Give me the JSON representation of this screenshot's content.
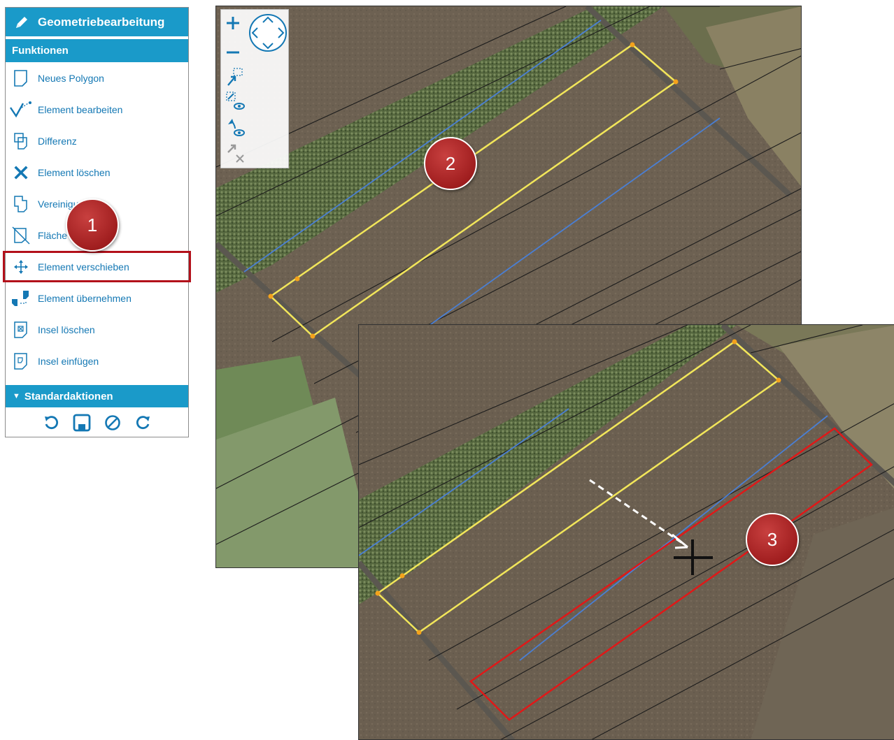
{
  "panel": {
    "title": "Geometriebearbeitung",
    "section_title": "Funktionen",
    "functions": [
      {
        "label": "Neues Polygon",
        "icon": "new-polygon-icon"
      },
      {
        "label": "Element bearbeiten",
        "icon": "edit-element-icon"
      },
      {
        "label": "Differenz",
        "icon": "difference-icon"
      },
      {
        "label": "Element löschen",
        "icon": "delete-icon"
      },
      {
        "label": "Vereinigung",
        "icon": "union-icon"
      },
      {
        "label": "Fläche teilen",
        "icon": "split-area-icon"
      },
      {
        "label": "Element verschieben",
        "icon": "move-icon",
        "selected": true
      },
      {
        "label": "Element übernehmen",
        "icon": "adopt-element-icon"
      },
      {
        "label": "Insel löschen",
        "icon": "delete-island-icon"
      },
      {
        "label": "Insel einfügen",
        "icon": "insert-island-icon"
      }
    ],
    "standard_actions_title": "Standardaktionen",
    "standard_actions": [
      "undo-icon",
      "save-icon",
      "cancel-icon",
      "redo-icon"
    ]
  },
  "badges": {
    "one": "1",
    "two": "2",
    "three": "3"
  },
  "colors": {
    "accent": "#1a9ac9",
    "selection_outline": "#b3101a",
    "link_text": "#1478b4",
    "field_boundary_yellow": "#f2e65a",
    "boundary_blue": "#4a7fd4",
    "moved_element_red": "#e01818",
    "badge_red": "#a01e1f"
  }
}
